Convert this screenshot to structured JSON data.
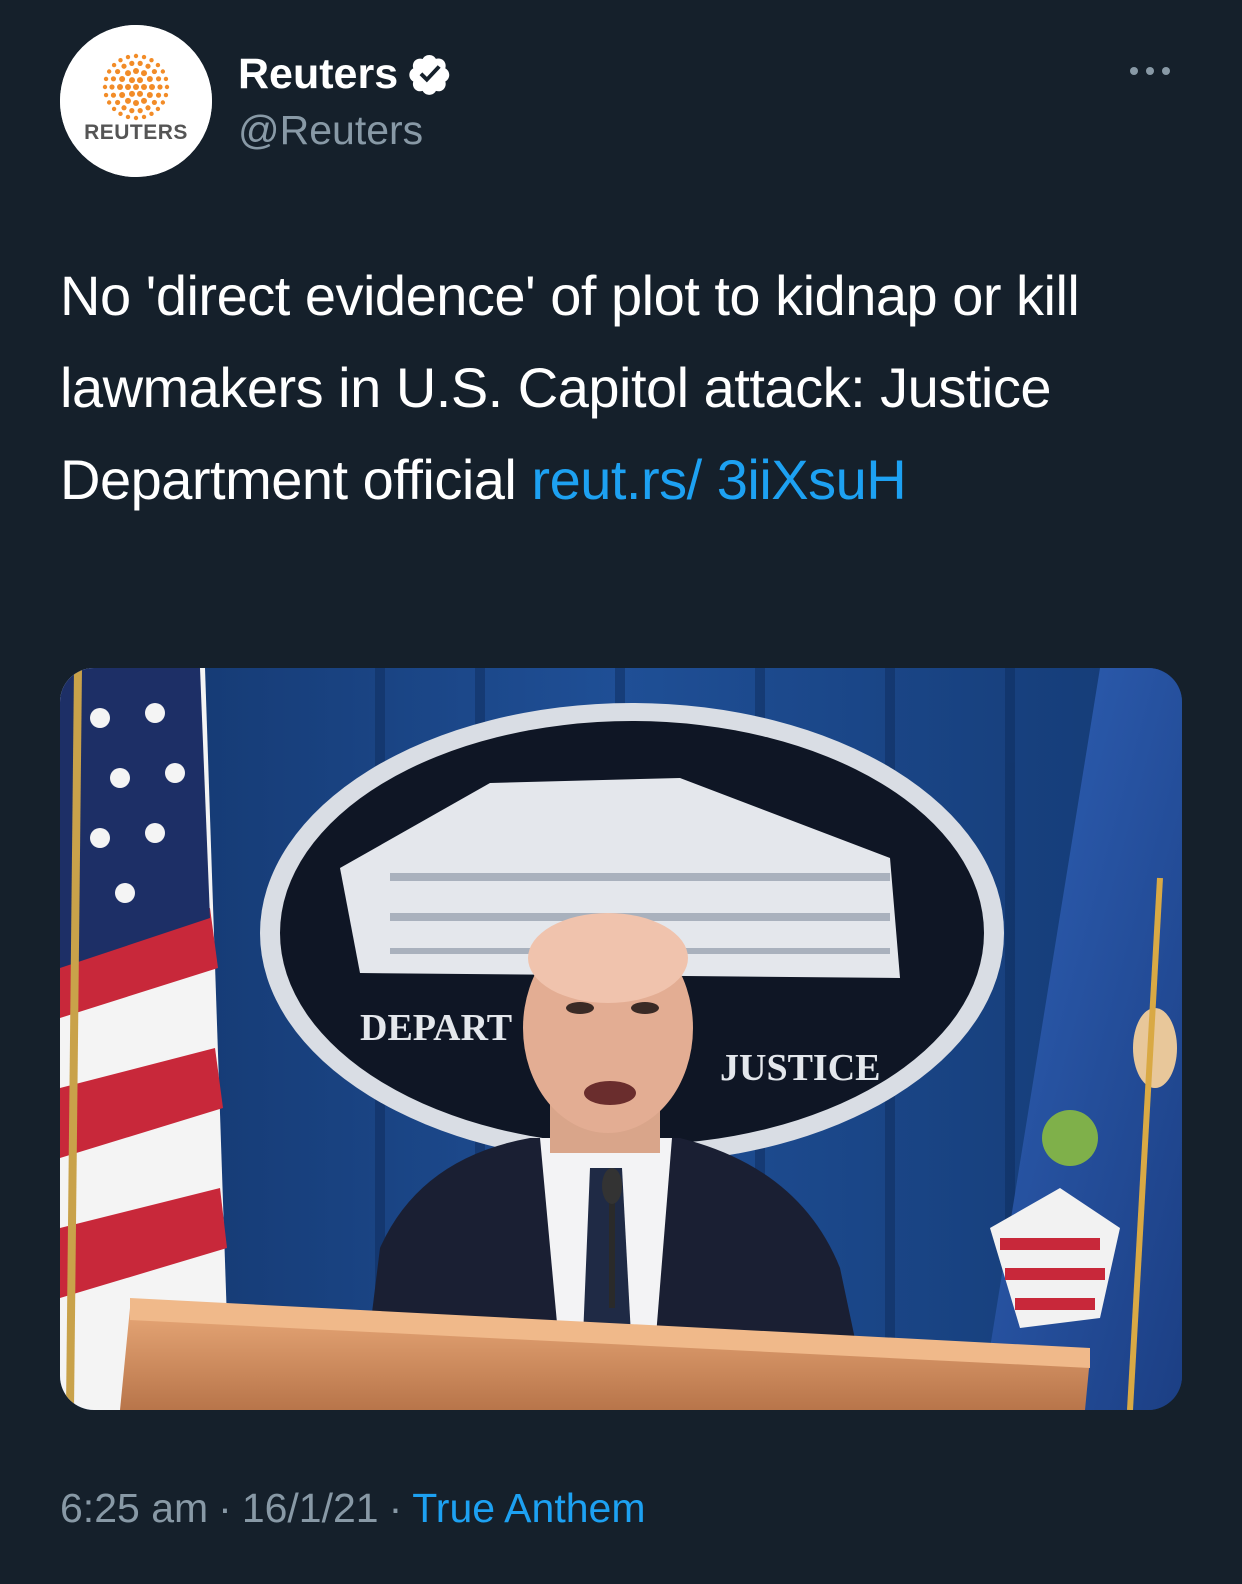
{
  "colors": {
    "background": "#15202b",
    "text_primary": "#ffffff",
    "text_secondary": "#8899a6",
    "link": "#1da1f2",
    "avatar_accent": "#f28c28"
  },
  "author": {
    "display_name": "Reuters",
    "handle": "@Reuters",
    "verified": true,
    "avatar_icon": "reuters-logo",
    "avatar_wordmark": "REUTERS"
  },
  "header": {
    "more_icon": "more-dots-icon"
  },
  "tweet": {
    "text": "No 'direct evidence' of plot to kidnap or kill lawmakers in U.S. Capitol attack: Justice Department official ",
    "link_text": "reut.rs/ 3iiXsuH"
  },
  "media": {
    "seal_text_left": "DEPART",
    "seal_text_right": "JUSTICE"
  },
  "meta": {
    "time": "6:25 am",
    "date": "16/1/21",
    "source": "True Anthem",
    "separator": "·"
  }
}
